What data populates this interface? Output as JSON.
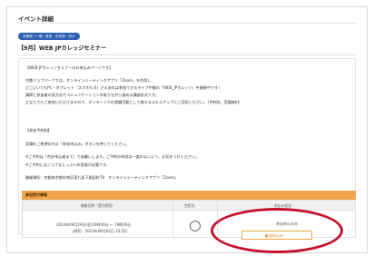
{
  "section": {
    "title": "イベント詳細"
  },
  "tag": {
    "label": "京都館（一般・参加・交流会）向け"
  },
  "event": {
    "title": "【9月】WEB JPカレッジセミナー"
  },
  "description": {
    "heading": "【WEB JPカレッジセミナーのお申込みページです】",
    "lines": [
      "京都ジョブパークでは、オンラインミーティングアプリ「Zoom」を利用し、",
      "どこにいてもPC・タブレット（スマホも可）さえあれば参加できるライブ中継の「WEB_JPカレッジ」を開催中です！",
      "講師と参加者の双方向でコミュニケーションを取りながら進める講座形式です。",
      "どなたでもご参加いただけますので、オンラインでの就職活動として様々なスキルアップにご活用ください。（予約制、受講無料）"
    ],
    "booking_heading": "【参加予約制】",
    "booking_line": "受講をご希望の方は「参加申込み」ボタンを押してください。",
    "notes": [
      "※ご予約は「合計申込者まで」であ願いします。ご予約の有効は一度のないよう、お気をつけください。",
      "※ご予約にはジョブなとっぷへの登録が必要です。"
    ],
    "venue": "開催場所：京都府京都市南区東九条下殿田町70　オンラインミーティングアプリ「Zoom」"
  },
  "registration": {
    "header": "参加受付情報",
    "columns": {
      "date": "開催日時（受付締切）",
      "select": "空状況",
      "status": "申込み状況"
    },
    "row": {
      "date_main": "2023年09月29日(金)19時30分 〜 19時30分",
      "deadline": "(締切：2023年09月02日 23:55)",
      "status": "参加申込み未",
      "apply_label": "参加申込み",
      "apply_arrow": "▶"
    }
  },
  "colors": {
    "accent": "#f2a44a",
    "pill": "#2f5fb3",
    "highlight": "#c80f2e"
  }
}
